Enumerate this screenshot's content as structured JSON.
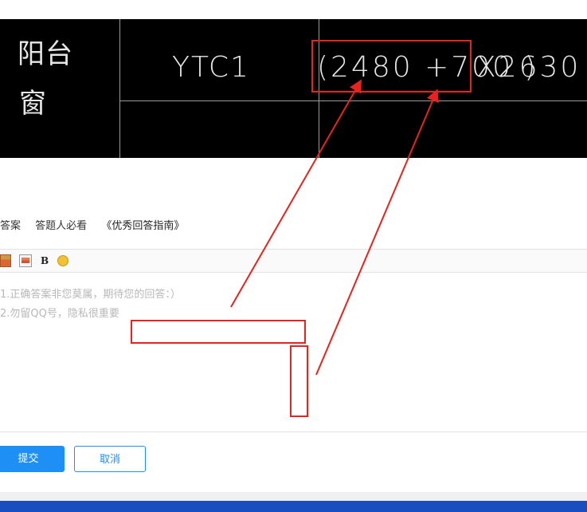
{
  "cad_drawing": {
    "room_label_line1": "阳台",
    "room_label_line2": "窗",
    "window_code": "YTC1",
    "width_dimension": "(2480 +700 )",
    "height_dimension": "X2630"
  },
  "answer_links": {
    "my_answer": "我的答案",
    "must_read": "答题人必看",
    "guide": "《优秀回答指南》"
  },
  "editor": {
    "toolbar": {
      "insert_image_icon": "image-icon",
      "insert_gallery_icon": "picture-icon",
      "bold_label": "B",
      "emoji_icon": "smiley-icon"
    },
    "placeholder_line1": "1.正确答案非您莫属，期待您的回答：）",
    "placeholder_line2": "2.勿留QQ号，隐私很重要"
  },
  "actions": {
    "submit_label": "提交",
    "cancel_label": "取消"
  },
  "colors": {
    "annotation_red": "#e8231d",
    "primary_blue": "#1e8ff5",
    "footer_blue": "#1a4ec0"
  }
}
